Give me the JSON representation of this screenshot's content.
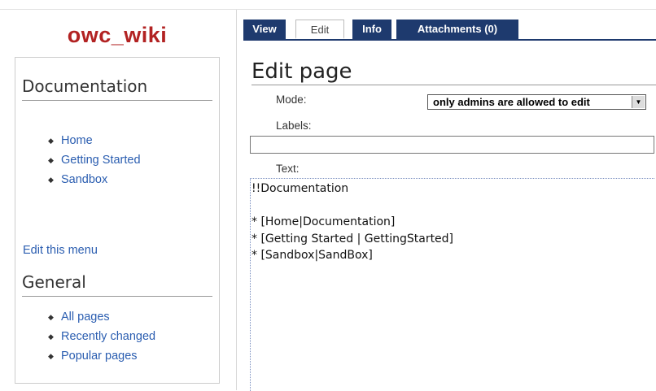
{
  "site": {
    "logo": "owc_wiki"
  },
  "sidebar": {
    "documentation": {
      "heading": "Documentation",
      "items": [
        {
          "label": "Home"
        },
        {
          "label": "Getting Started"
        },
        {
          "label": "Sandbox"
        }
      ]
    },
    "edit_menu_link": "Edit this menu",
    "general": {
      "heading": "General",
      "items": [
        {
          "label": "All pages"
        },
        {
          "label": "Recently changed"
        },
        {
          "label": "Popular pages"
        }
      ]
    }
  },
  "tabs": [
    {
      "label": "View",
      "active": false
    },
    {
      "label": "Edit",
      "active": true
    },
    {
      "label": "Info",
      "active": false
    },
    {
      "label": "Attachments (0)",
      "active": false
    }
  ],
  "editor": {
    "title": "Edit page",
    "mode_label": "Mode:",
    "mode_value": "only admins are allowed to edit",
    "labels_label": "Labels:",
    "labels_value": "",
    "text_label": "Text:",
    "text_value": "!!Documentation\n\n* [Home|Documentation]\n* [Getting Started | GettingStarted]\n* [Sandbox|SandBox]"
  },
  "colors": {
    "logo": "#b22222",
    "tab_background": "#1e3a6e",
    "link": "#2a5db0"
  }
}
